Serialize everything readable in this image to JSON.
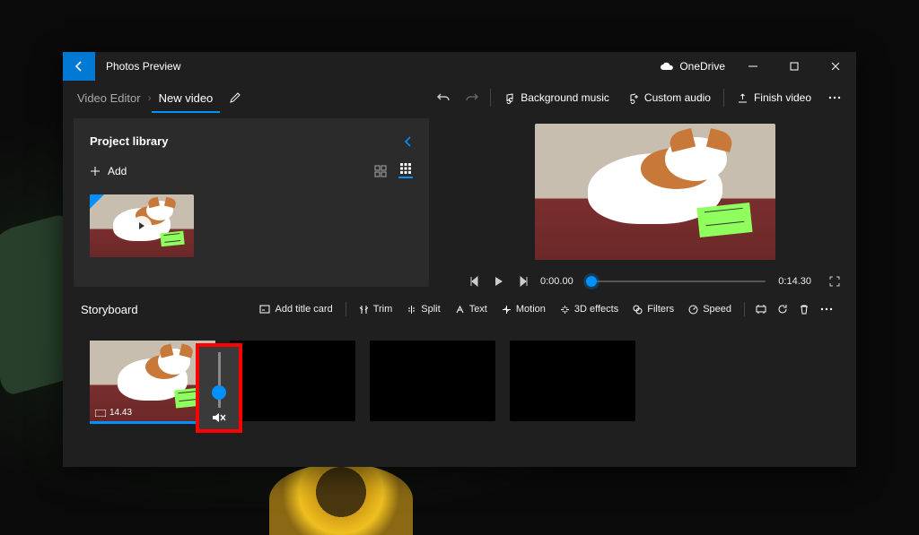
{
  "titlebar": {
    "title": "Photos Preview",
    "cloud": "OneDrive"
  },
  "breadcrumb": {
    "parent": "Video Editor",
    "current": "New video"
  },
  "toolbar": {
    "bg_music": "Background music",
    "custom_audio": "Custom audio",
    "finish": "Finish video"
  },
  "library": {
    "title": "Project library",
    "add": "Add"
  },
  "playback": {
    "current_time": "0:00.00",
    "total_time": "0:14.30"
  },
  "storyboard": {
    "title": "Storyboard",
    "add_title_card": "Add title card",
    "trim": "Trim",
    "split": "Split",
    "text": "Text",
    "motion": "Motion",
    "effects": "3D effects",
    "filters": "Filters",
    "speed": "Speed",
    "clip1_duration": "14.43"
  }
}
